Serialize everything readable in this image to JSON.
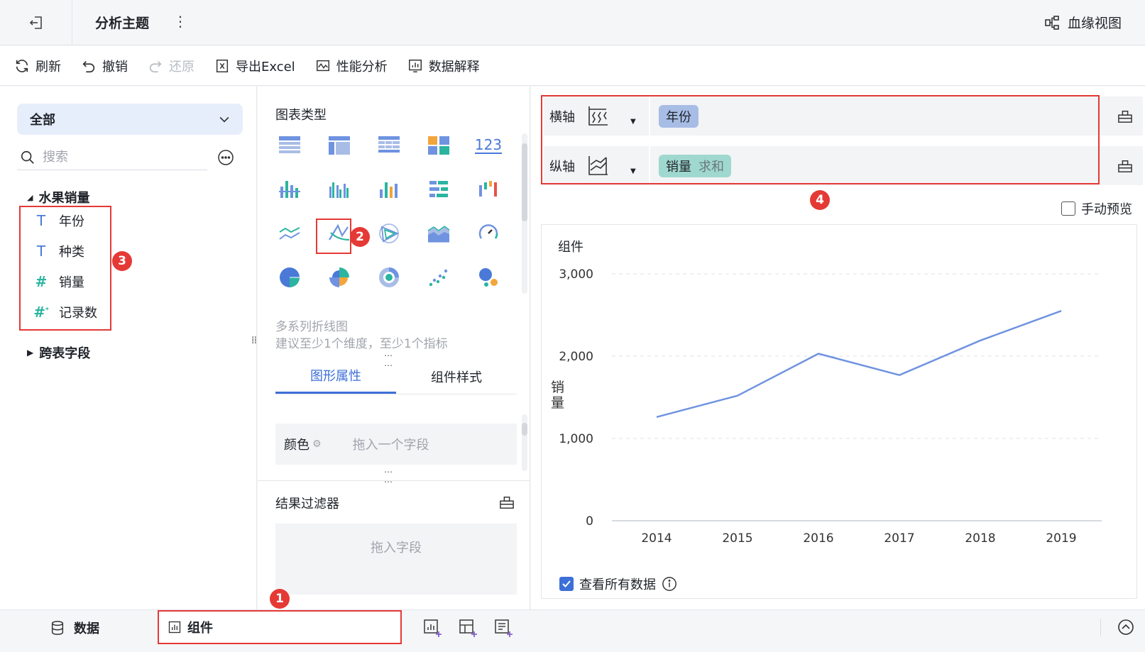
{
  "header": {
    "title": "分析主题",
    "lineage_label": "血缘视图"
  },
  "toolbar": {
    "refresh": "刷新",
    "undo": "撤销",
    "redo": "还原",
    "export_excel": "导出Excel",
    "performance": "性能分析",
    "data_explain": "数据解释"
  },
  "field_panel": {
    "scope_value": "全部",
    "search_placeholder": "搜索",
    "group_name": "水果销量",
    "fields": [
      {
        "name": "年份",
        "type": "dimension"
      },
      {
        "name": "种类",
        "type": "dimension"
      },
      {
        "name": "销量",
        "type": "measure"
      },
      {
        "name": "记录数",
        "type": "measure"
      }
    ],
    "cross_table_group": "跨表字段",
    "badge": "3"
  },
  "chart_type_panel": {
    "title": "图表类型",
    "selected_badge": "2",
    "selected_name": "多系列折线图",
    "selected_hint": "建议至少1个维度，至少1个指标",
    "tabs": [
      "图形属性",
      "组件样式"
    ],
    "color_label": "颜色",
    "color_placeholder": "拖入一个字段",
    "filter_title": "结果过滤器",
    "filter_placeholder": "拖入字段"
  },
  "axes": {
    "x_label": "横轴",
    "x_field": "年份",
    "y_label": "纵轴",
    "y_field": "销量",
    "y_agg": "求和",
    "badge": "4"
  },
  "manual_preview_label": "手动预览",
  "chart_data": {
    "type": "line",
    "title": "组件",
    "ylabel": "销量",
    "xlabel": "",
    "categories": [
      "2014",
      "2015",
      "2016",
      "2017",
      "2018",
      "2019"
    ],
    "series": [
      {
        "values": [
          1260,
          1520,
          2030,
          1770,
          2190,
          2550
        ]
      }
    ],
    "ylim": [
      0,
      3000
    ],
    "yticks": [
      "0",
      "1,000",
      "2,000",
      "3,000"
    ],
    "line_color": "#6f93e0",
    "grid": true
  },
  "view_all_label": "查看所有数据",
  "bottom": {
    "data_tab": "数据",
    "component_tab": "组件",
    "badge": "1"
  },
  "colors": {
    "accent": "#3d6fd8",
    "highlight": "#e53935",
    "dimension": "#4a79d8",
    "measure": "#2bb5a0"
  }
}
